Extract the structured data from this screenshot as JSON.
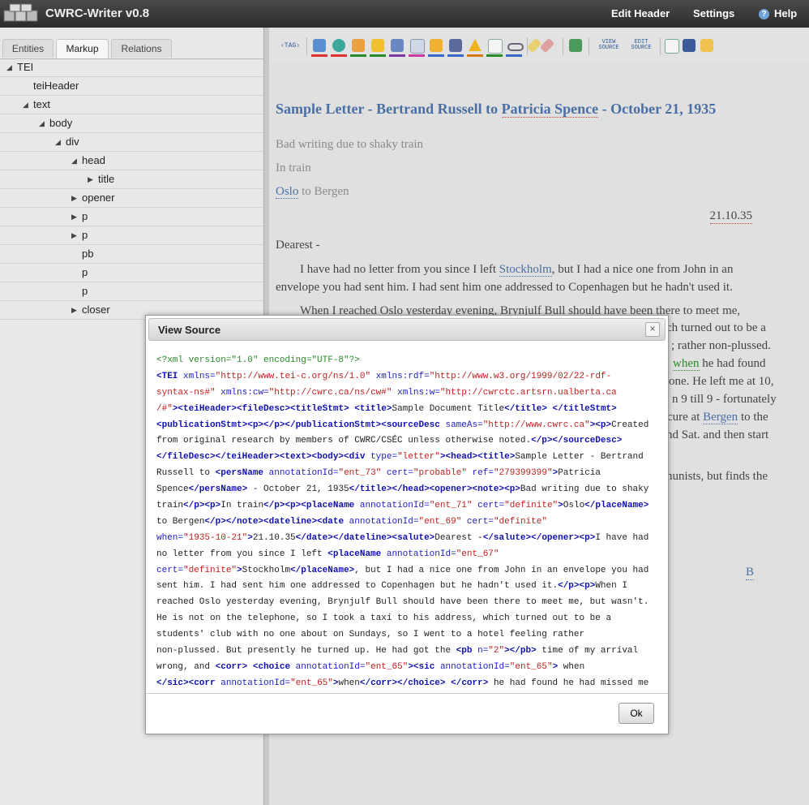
{
  "app": {
    "title": "CWRC-Writer v0.8"
  },
  "topbar": {
    "edit_header": "Edit Header",
    "settings": "Settings",
    "help": "Help"
  },
  "left_tabs": [
    "Entities",
    "Markup",
    "Relations"
  ],
  "tree": [
    {
      "label": "TEI"
    },
    {
      "label": "teiHeader"
    },
    {
      "label": "text"
    },
    {
      "label": "body"
    },
    {
      "label": "div"
    },
    {
      "label": "head"
    },
    {
      "label": "title"
    },
    {
      "label": "opener"
    },
    {
      "label": "p"
    },
    {
      "label": "p"
    },
    {
      "label": "pb"
    },
    {
      "label": "p"
    },
    {
      "label": "p"
    },
    {
      "label": "closer"
    }
  ],
  "toolbar": {
    "tag": "‹TAG›",
    "view_source": "VIEW SOURCE",
    "edit_source": "EDIT SOURCE"
  },
  "editor": {
    "title_a": "Sample Letter - Bertrand Russell to ",
    "title_b": "Patricia Spence",
    "title_c": " - October 21, 1935",
    "note1": "Bad writing due to shaky train",
    "note2": "In train",
    "dateline_a": "Oslo",
    "dateline_b": " to Bergen",
    "date": "21.10.35",
    "salute": "Dearest -",
    "p1_a": "I have had no letter from you since I left ",
    "p1_b": "Stockholm",
    "p1_c": ", but I had a nice one from John in an envelope you had sent him. I had sent him one addressed to Copenhagen but he hadn't used it.",
    "p2": "When I reached Oslo yesterday evening, Brynjulf Bull should have been there to meet me,",
    "f1": "ch turned out to be a",
    "f2": "; rather non-plussed.",
    "f3a": "when",
    "f3b": " he had found",
    "f4": "one. He left me at 10,",
    "f5": "n 9 till 9 - fortunately",
    "f6a": "cure at ",
    "f6b": "Bergen",
    "f6c": " to the",
    "f7": "nd Sat. and then start",
    "f8": "nunists, but finds the",
    "f9": "B"
  },
  "modal": {
    "title": "View Source",
    "close": "×",
    "ok": "Ok",
    "lines": [
      [
        [
          "pi",
          "<?xml version=\"1.0\" encoding=\"UTF-8\"?>"
        ]
      ],
      [
        [
          "tg",
          "<TEI"
        ],
        [
          "tx",
          " "
        ],
        [
          "at",
          "xmlns="
        ],
        [
          "av",
          "\"http://www.tei-c.org/ns/1.0\""
        ],
        [
          "tx",
          " "
        ],
        [
          "at",
          "xmlns:rdf="
        ],
        [
          "av",
          "\"http://www.w3.org/1999/02/22-rdf-"
        ]
      ],
      [
        [
          "av",
          "syntax-ns#\""
        ],
        [
          "tx",
          " "
        ],
        [
          "at",
          "xmlns:cw="
        ],
        [
          "av",
          "\"http://cwrc.ca/ns/cw#\""
        ],
        [
          "tx",
          " "
        ],
        [
          "at",
          "xmlns:w="
        ],
        [
          "av",
          "\"http://cwrctc.artsrn.ualberta.ca"
        ]
      ],
      [
        [
          "av",
          "/#\""
        ],
        [
          "tg",
          ">"
        ],
        [
          "tg",
          "<teiHeader><fileDesc><titleStmt>"
        ],
        [
          "tx",
          " "
        ],
        [
          "tg",
          "<title>"
        ],
        [
          "tx",
          "Sample Document Title"
        ],
        [
          "tg",
          "</title>"
        ],
        [
          "tx",
          " "
        ],
        [
          "tg",
          "</titleStmt>"
        ]
      ],
      [
        [
          "tg",
          "<publicationStmt><p></p></publicationStmt><sourceDesc"
        ],
        [
          "tx",
          " "
        ],
        [
          "at",
          "sameAs="
        ],
        [
          "av",
          "\"http://www.cwrc.ca\""
        ],
        [
          "tg",
          "><p>"
        ],
        [
          "tx",
          "Created"
        ]
      ],
      [
        [
          "tx",
          "from original research by members of CWRC/CSÉC unless otherwise noted."
        ],
        [
          "tg",
          "</p></sourceDesc>"
        ]
      ],
      [
        [
          "tg",
          "</fileDesc></teiHeader><text><body><div"
        ],
        [
          "tx",
          " "
        ],
        [
          "at",
          "type="
        ],
        [
          "av",
          "\"letter\""
        ],
        [
          "tg",
          "><head><title>"
        ],
        [
          "tx",
          "Sample Letter - Bertrand"
        ]
      ],
      [
        [
          "tx",
          "Russell to "
        ],
        [
          "tg",
          "<persName"
        ],
        [
          "tx",
          " "
        ],
        [
          "at",
          "annotationId="
        ],
        [
          "av",
          "\"ent_73\""
        ],
        [
          "tx",
          " "
        ],
        [
          "at",
          "cert="
        ],
        [
          "av",
          "\"probable\""
        ],
        [
          "tx",
          " "
        ],
        [
          "at",
          "ref="
        ],
        [
          "av",
          "\"279399399\""
        ],
        [
          "tg",
          ">"
        ],
        [
          "tx",
          "Patricia"
        ]
      ],
      [
        [
          "tx",
          "Spence"
        ],
        [
          "tg",
          "</persName>"
        ],
        [
          "tx",
          " - October 21, 1935"
        ],
        [
          "tg",
          "</title></head><opener><note><p>"
        ],
        [
          "tx",
          "Bad writing due to shaky"
        ]
      ],
      [
        [
          "tx",
          "train"
        ],
        [
          "tg",
          "</p><p>"
        ],
        [
          "tx",
          "In train"
        ],
        [
          "tg",
          "</p><p><placeName"
        ],
        [
          "tx",
          " "
        ],
        [
          "at",
          "annotationId="
        ],
        [
          "av",
          "\"ent_71\""
        ],
        [
          "tx",
          " "
        ],
        [
          "at",
          "cert="
        ],
        [
          "av",
          "\"definite\""
        ],
        [
          "tg",
          ">"
        ],
        [
          "tx",
          "Oslo"
        ],
        [
          "tg",
          "</placeName>"
        ]
      ],
      [
        [
          "tx",
          "to Bergen"
        ],
        [
          "tg",
          "</p></note><dateline><date"
        ],
        [
          "tx",
          " "
        ],
        [
          "at",
          "annotationId="
        ],
        [
          "av",
          "\"ent_69\""
        ],
        [
          "tx",
          " "
        ],
        [
          "at",
          "cert="
        ],
        [
          "av",
          "\"definite\""
        ]
      ],
      [
        [
          "at",
          "when="
        ],
        [
          "av",
          "\"1935-10-21\""
        ],
        [
          "tg",
          ">"
        ],
        [
          "tx",
          "21.10.35"
        ],
        [
          "tg",
          "</date></dateline><salute>"
        ],
        [
          "tx",
          "Dearest -"
        ],
        [
          "tg",
          "</salute></opener><p>"
        ],
        [
          "tx",
          "I have had"
        ]
      ],
      [
        [
          "tx",
          "no letter from you since I left "
        ],
        [
          "tg",
          "<placeName"
        ],
        [
          "tx",
          " "
        ],
        [
          "at",
          "annotationId="
        ],
        [
          "av",
          "\"ent_67\""
        ]
      ],
      [
        [
          "at",
          "cert="
        ],
        [
          "av",
          "\"definite\""
        ],
        [
          "tg",
          ">"
        ],
        [
          "tx",
          "Stockholm"
        ],
        [
          "tg",
          "</placeName>"
        ],
        [
          "tx",
          ", but I had a nice one from John in an envelope you had"
        ]
      ],
      [
        [
          "tx",
          "sent him. I had sent him one addressed to Copenhagen but he hadn't used it."
        ],
        [
          "tg",
          "</p><p>"
        ],
        [
          "tx",
          "When I"
        ]
      ],
      [
        [
          "tx",
          "reached Oslo yesterday evening, Brynjulf Bull should have been there to meet me, but wasn't."
        ]
      ],
      [
        [
          "tx",
          "He is not on the telephone, so I took a taxi to his address, which turned out to be a"
        ]
      ],
      [
        [
          "tx",
          "students' club with no one about on Sundays, so I went to a hotel feeling rather"
        ]
      ],
      [
        [
          "tx",
          "non-plussed. But presently he turned up. He had got the "
        ],
        [
          "tg",
          "<pb"
        ],
        [
          "tx",
          " "
        ],
        [
          "at",
          "n="
        ],
        [
          "av",
          "\"2\""
        ],
        [
          "tg",
          "></pb>"
        ],
        [
          "tx",
          " time of my arrival"
        ]
      ],
      [
        [
          "tx",
          "wrong, and "
        ],
        [
          "tg",
          "<corr>"
        ],
        [
          "tx",
          " "
        ],
        [
          "tg",
          "<choice"
        ],
        [
          "tx",
          " "
        ],
        [
          "at",
          "annotationId="
        ],
        [
          "av",
          "\"ent_65\""
        ],
        [
          "tg",
          "><sic"
        ],
        [
          "tx",
          " "
        ],
        [
          "at",
          "annotationId="
        ],
        [
          "av",
          "\"ent_65\""
        ],
        [
          "tg",
          ">"
        ],
        [
          "tx",
          " when"
        ]
      ],
      [
        [
          "tg",
          "</sic><corr"
        ],
        [
          "tx",
          " "
        ],
        [
          "at",
          "annotationId="
        ],
        [
          "av",
          "\"ent_65\""
        ],
        [
          "tg",
          ">"
        ],
        [
          "tx",
          "when"
        ],
        [
          "tg",
          "</corr></choice>"
        ],
        [
          "tx",
          " "
        ],
        [
          "tg",
          "</corr>"
        ],
        [
          "tx",
          " he had found he had missed me"
        ]
      ]
    ]
  }
}
